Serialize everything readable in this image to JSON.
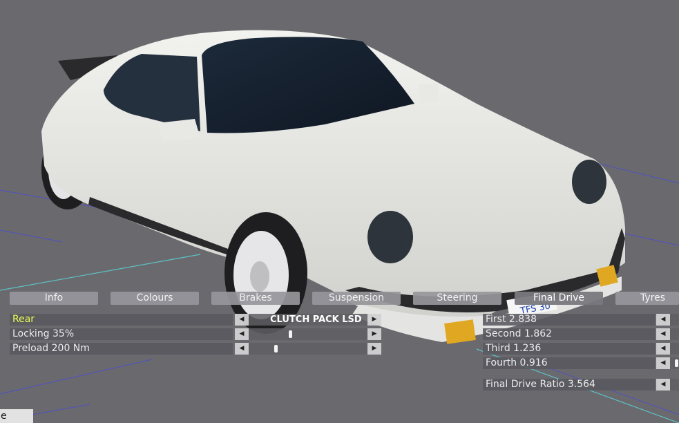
{
  "tabs": [
    {
      "label": "Info"
    },
    {
      "label": "Colours"
    },
    {
      "label": "Brakes"
    },
    {
      "label": "Suspension"
    },
    {
      "label": "Steering"
    },
    {
      "label": "Final Drive",
      "active": true
    },
    {
      "label": "Tyres"
    }
  ],
  "differential": {
    "axle": "Rear",
    "type": "CLUTCH PACK LSD",
    "locking": {
      "label": "Locking 35%",
      "fraction": 0.35
    },
    "preload": {
      "label": "Preload 200 Nm",
      "fraction": 0.22
    }
  },
  "gears": [
    {
      "label": "First 2.838"
    },
    {
      "label": "Second 1.862"
    },
    {
      "label": "Third 1.236"
    },
    {
      "label": "Fourth 0.916"
    }
  ],
  "final_drive": {
    "label": "Final Drive Ratio 3.564"
  },
  "plate_text": "TFS 30",
  "bottom_button": {
    "label": "e"
  },
  "icons": {
    "decrease": "left-arrow-icon",
    "increase": "right-arrow-icon"
  }
}
